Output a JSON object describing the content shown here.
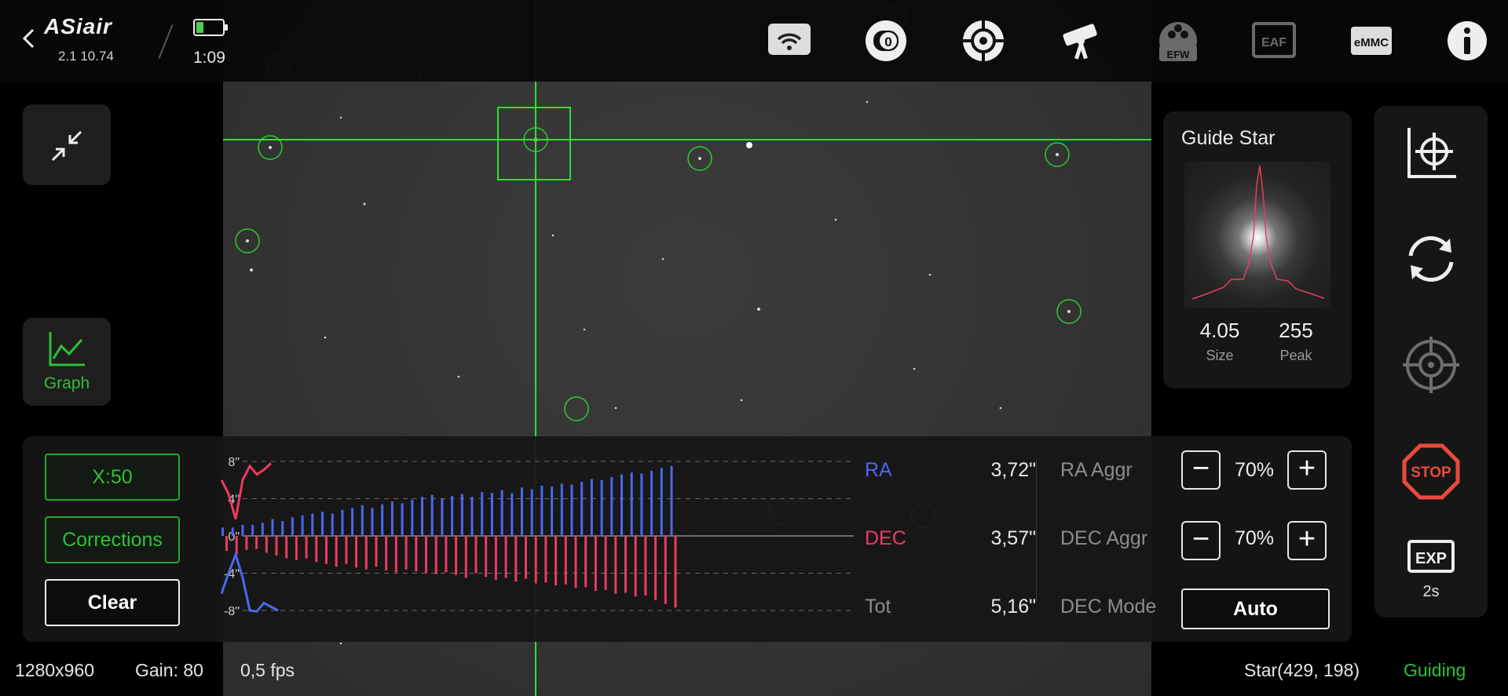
{
  "topbar": {
    "brand": "ASiair",
    "version": "2.1 10.74",
    "battery_level": 0.25,
    "timer": "1:09",
    "icons": [
      "wifi-icon",
      "camera-icon",
      "guide-icon",
      "telescope-icon",
      "efw-icon",
      "eaf-icon",
      "emmc-icon",
      "info-icon"
    ],
    "efw_label": "EFW",
    "eaf_label": "EAF",
    "emmc_label": "eMMC"
  },
  "left": {
    "collapse_icon": "collapse-icon",
    "graph_label": "Graph"
  },
  "guide_star": {
    "title": "Guide Star",
    "size_value": "4.05",
    "size_label": "Size",
    "peak_value": "255",
    "peak_label": "Peak"
  },
  "rightbar": {
    "icons": [
      "calibrate-icon",
      "loop-icon",
      "crosshair-target-icon",
      "stop-icon",
      "exposure-icon"
    ],
    "stop_label": "STOP",
    "exp_label": "EXP",
    "exposure": "2s"
  },
  "guide_panel": {
    "scale_button": "X:50",
    "corrections_button": "Corrections",
    "clear_button": "Clear",
    "ra_label": "RA",
    "ra_value": "3,72\"",
    "dec_label": "DEC",
    "dec_value": "3,57\"",
    "tot_label": "Tot",
    "tot_value": "5,16\"",
    "ra_aggr_label": "RA Aggr",
    "ra_aggr_value": "70%",
    "dec_aggr_label": "DEC Aggr",
    "dec_aggr_value": "70%",
    "dec_mode_label": "DEC Mode",
    "dec_mode_value": "Auto",
    "minus": "−",
    "plus": "+"
  },
  "colors": {
    "ra": "#4a67f0",
    "dec": "#ee3a5e",
    "green": "#2fbf3a",
    "crosshair": "#2ee02e"
  },
  "chart_data": {
    "type": "bar",
    "ylabel_ticks": [
      "8\"",
      "4\"",
      "0\"",
      "-4\"",
      "-8\""
    ],
    "ylim": [
      -8,
      8
    ],
    "series": [
      {
        "name": "RA",
        "values": [
          0.9,
          0.9,
          1.2,
          1.2,
          1.4,
          1.8,
          1.6,
          2.0,
          2.2,
          2.4,
          2.6,
          2.4,
          2.8,
          3.0,
          3.3,
          3.0,
          3.4,
          3.7,
          3.5,
          3.9,
          4.2,
          4.4,
          4.0,
          4.3,
          4.5,
          4.2,
          4.7,
          4.6,
          4.9,
          4.6,
          5.2,
          5.0,
          5.4,
          5.3,
          5.6,
          5.5,
          5.8,
          6.1,
          6.0,
          6.3,
          6.6,
          6.8,
          6.7,
          7.0,
          7.3,
          7.5
        ]
      },
      {
        "name": "DEC",
        "values": [
          -1.6,
          -2.0,
          -1.5,
          -1.4,
          -1.8,
          -2.1,
          -2.4,
          -2.6,
          -2.4,
          -2.8,
          -3.0,
          -3.3,
          -3.0,
          -3.4,
          -3.6,
          -3.3,
          -3.7,
          -3.9,
          -3.6,
          -3.8,
          -4.0,
          -4.1,
          -3.9,
          -4.2,
          -4.5,
          -4.0,
          -4.4,
          -4.7,
          -4.5,
          -4.9,
          -4.6,
          -5.1,
          -5.0,
          -5.3,
          -5.2,
          -5.6,
          -5.5,
          -5.9,
          -5.8,
          -6.2,
          -6.1,
          -6.5,
          -6.4,
          -6.9,
          -7.3,
          -7.7
        ]
      },
      {
        "name": "RA-trace",
        "values": [
          6.0,
          4.5,
          1.8,
          6.0,
          7.5,
          6.6,
          7.1,
          7.8
        ]
      },
      {
        "name": "DEC-trace",
        "values": [
          -6.2,
          -4.0,
          -2.0,
          -4.5,
          -8.0,
          -8.1,
          -7.2,
          -7.6,
          -8.0
        ]
      }
    ]
  },
  "statusbar": {
    "resolution": "1280x960",
    "gain": "Gain: 80",
    "fps": "0,5 fps",
    "star": "Star(429, 198)",
    "state": "Guiding"
  }
}
